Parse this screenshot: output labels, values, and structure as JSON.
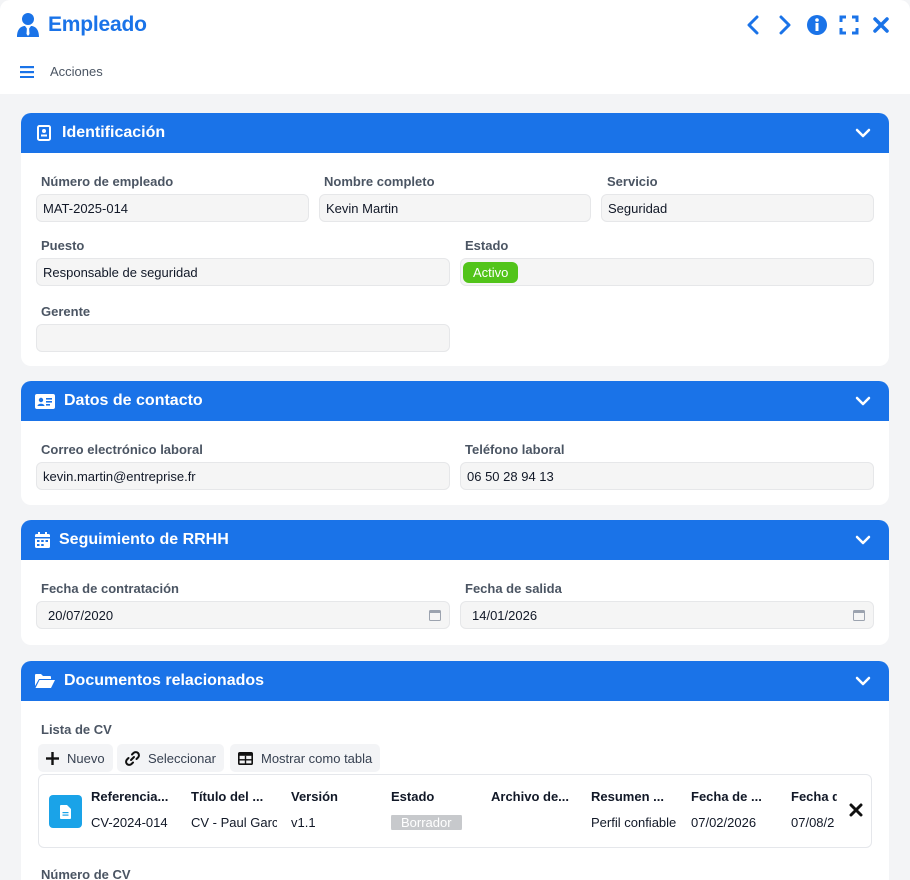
{
  "window": {
    "title": "Empleado",
    "actions_label": "Acciones"
  },
  "colors": {
    "accent": "#1a73e8",
    "active": "#52c41a",
    "draft": "#c7c9cc",
    "doc_icon": "#1aa3e8"
  },
  "identification": {
    "title": "Identificación",
    "employee_number_label": "Número de empleado",
    "employee_number": "MAT-2025-014",
    "full_name_label": "Nombre completo",
    "full_name": "Kevin Martin",
    "service_label": "Servicio",
    "service": "Seguridad",
    "position_label": "Puesto",
    "position": "Responsable de seguridad",
    "status_label": "Estado",
    "status": "Activo",
    "manager_label": "Gerente",
    "manager": ""
  },
  "contact": {
    "title": "Datos de contacto",
    "email_label": "Correo electrónico laboral",
    "email": "kevin.martin@entreprise.fr",
    "phone_label": "Teléfono laboral",
    "phone": "06 50 28 94 13"
  },
  "hr": {
    "title": "Seguimiento de RRHH",
    "hire_date_label": "Fecha de contratación",
    "hire_date": "20/07/2020",
    "exit_date_label": "Fecha de salida",
    "exit_date": "14/01/2026"
  },
  "documents": {
    "title": "Documentos relacionados",
    "cv_list_label": "Lista de CV",
    "new_label": "Nuevo",
    "select_label": "Seleccionar",
    "table_label": "Mostrar como tabla",
    "columns": [
      "Referencia...",
      "Título del ...",
      "Versión",
      "Estado",
      "Archivo de...",
      "Resumen ...",
      "Fecha de ...",
      "Fecha d"
    ],
    "row": {
      "reference": "CV-2024-014",
      "title": "CV - Paul Garcia",
      "version": "v1.1",
      "status": "Borrador",
      "file": "",
      "summary": "Perfil confiable",
      "date1": "07/02/2026",
      "date2": "07/08/2"
    },
    "cv_number_label": "Número de CV"
  }
}
